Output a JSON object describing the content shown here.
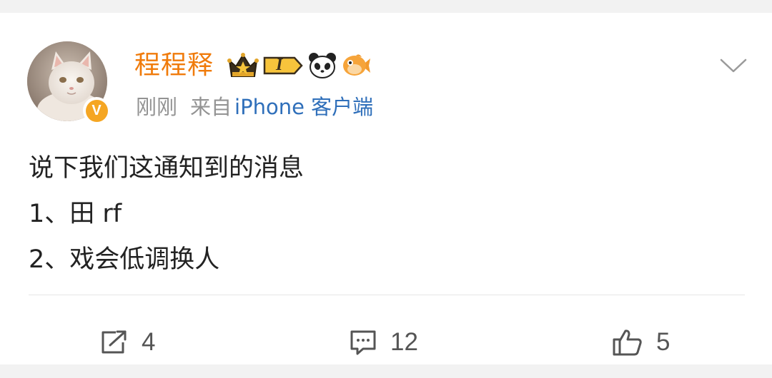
{
  "post": {
    "author": "程程释",
    "time": "刚刚",
    "from_label": "来自",
    "source": "iPhone 客户端",
    "content_lines": [
      "说下我们这通知到的消息",
      "1、田 rf",
      "2、戏会低调换人"
    ]
  },
  "badges": {
    "level_text": "I",
    "icons": [
      "crown-icon",
      "level-badge-icon",
      "panda-icon",
      "fish-icon"
    ]
  },
  "actions": {
    "repost_count": "4",
    "comment_count": "12",
    "like_count": "5"
  },
  "colors": {
    "author": "#f07b0b",
    "source": "#2f6fba",
    "meta": "#939393",
    "verified": "#f5a623"
  }
}
